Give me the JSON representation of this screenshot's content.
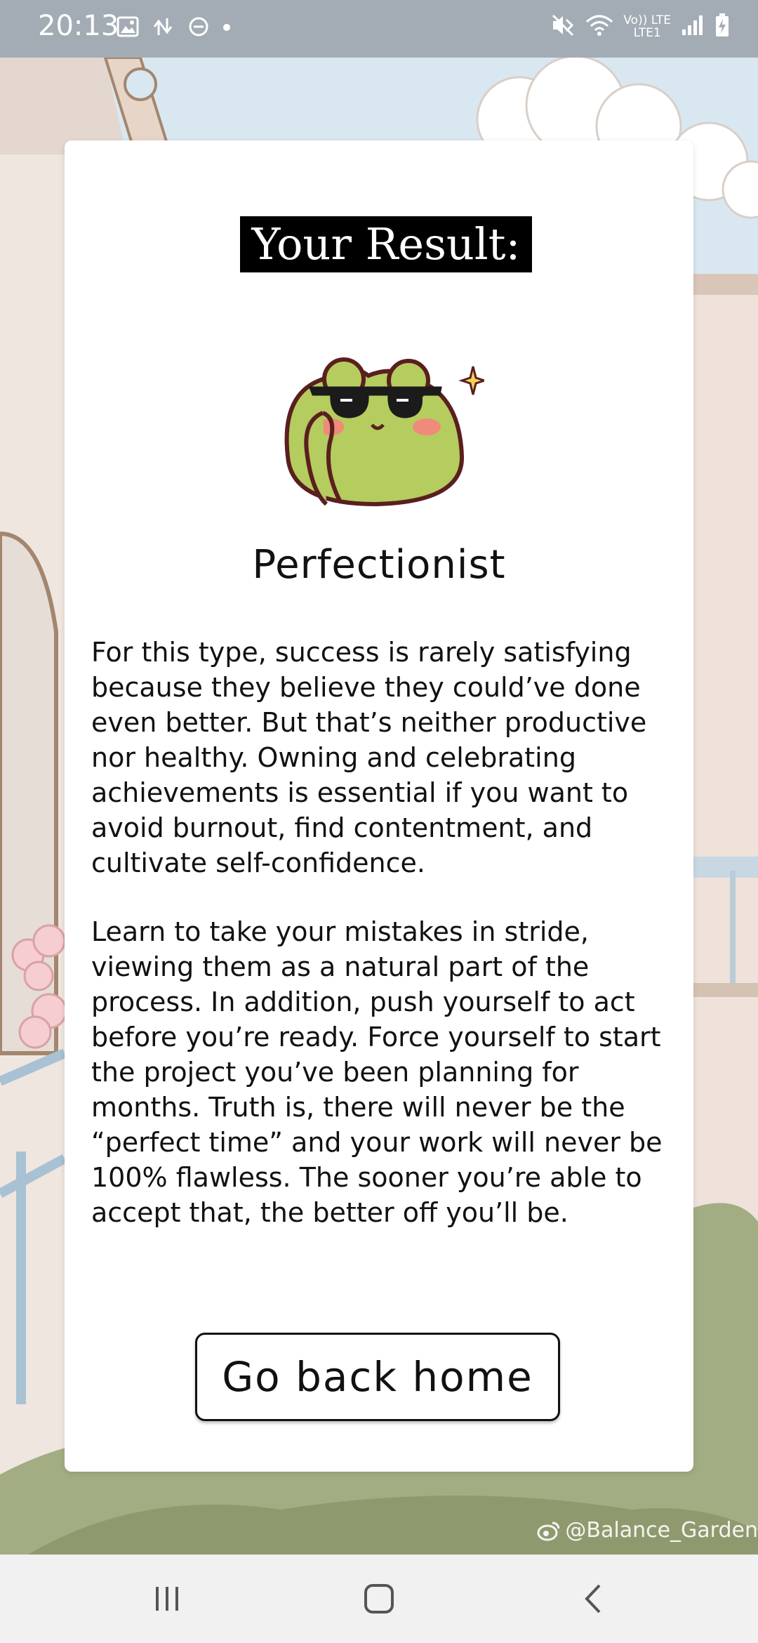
{
  "status_bar": {
    "time": "20:13",
    "lte_top": "Vo)) LTE",
    "lte_bottom": "LTE1"
  },
  "card": {
    "heading": "Your Result:",
    "result_type": "Perfectionist",
    "paragraphs": [
      "For this type, success is rarely satisfying because they believe they could’ve done even better. But that’s neither productive nor healthy. Owning and celebrating achievements is essential if you want to avoid burnout, find contentment, and cultivate self-confidence.",
      "Learn to take your mistakes in stride, viewing them as a natural part of the process. In addition, push yourself to act before you’re ready. Force yourself to start the project you’ve been planning for months. Truth is, there will never be the “perfect time” and your work will never be 100% flawless. The sooner you’re able to accept that, the better off you’ll be."
    ],
    "home_button_label": "Go back home"
  },
  "watermark": "@Balance_Garden",
  "icons": {
    "status_left": [
      "image-icon",
      "data-transfer-icon",
      "do-not-disturb-icon",
      "dot-icon"
    ],
    "status_right": [
      "mute-icon",
      "wifi-icon",
      "signal-icon",
      "battery-charging-icon"
    ],
    "nav": [
      "recents-icon",
      "home-icon",
      "back-icon"
    ]
  },
  "colors": {
    "status_bar": "#a3acb4",
    "card": "#ffffff",
    "heading_bg": "#000000",
    "frog_green": "#b5cc5e",
    "nav_bar": "#f1f1f1"
  }
}
